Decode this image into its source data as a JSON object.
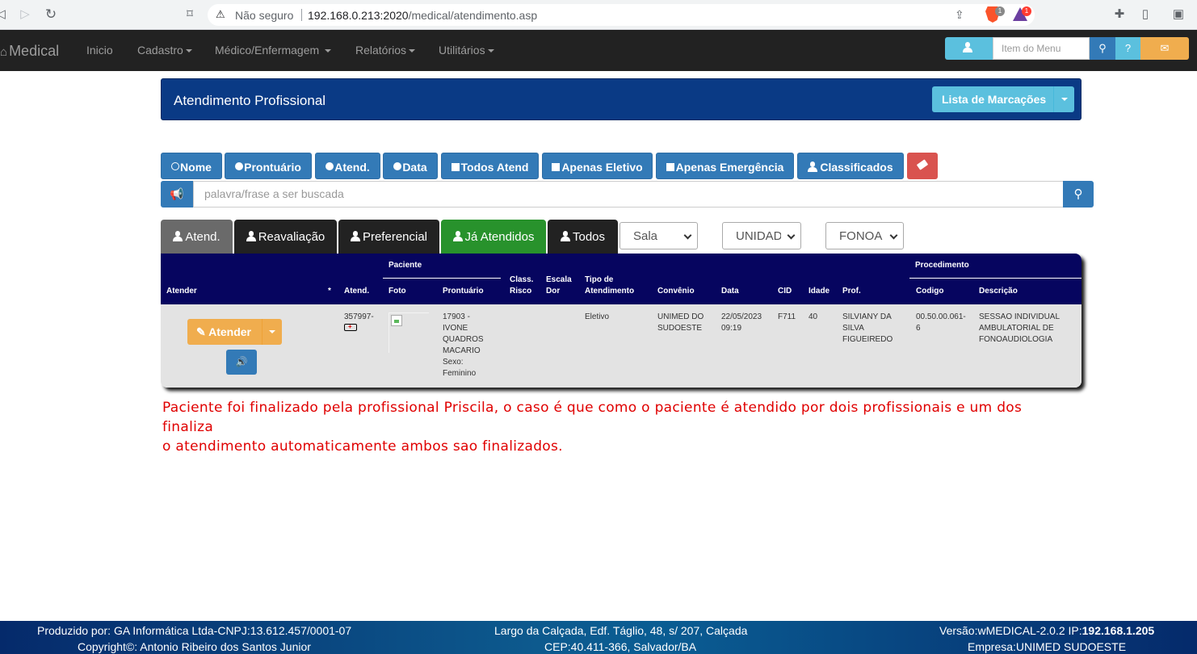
{
  "browser": {
    "insecure_label": "Não seguro",
    "url_host": "192.168.0.213:2020",
    "url_path": "/medical/atendimento.asp",
    "brave_badge": "1",
    "alert_badge": "1"
  },
  "navbar": {
    "brand": "Medical",
    "items": [
      "Inicio",
      "Cadastro",
      "Médico/Enfermagem",
      "Relatórios",
      "Utilitários"
    ],
    "search_placeholder": "Item do Menu"
  },
  "panel": {
    "title": "Atendimento Profissional",
    "lista_button": "Lista de Marcações"
  },
  "filters": [
    "Nome",
    "Prontuário",
    "Atend.",
    "Data",
    "Todos Atend",
    "Apenas Eletivo",
    "Apenas Emergência",
    "Classificados"
  ],
  "search": {
    "placeholder": "palavra/frase a ser buscada"
  },
  "tabs": [
    "Atend.",
    "Reavaliação",
    "Preferencial",
    "Já Atendidos",
    "Todos"
  ],
  "selects": {
    "sala": "Sala",
    "unidade": "UNIDADE",
    "fonoa": "FONOA"
  },
  "table": {
    "group_paciente": "Paciente",
    "group_procedimento": "Procedimento",
    "headers": {
      "atender": "Atender",
      "star": "*",
      "atend": "Atend.",
      "foto": "Foto",
      "prontuario": "Prontuário",
      "class_risco_1": "Class.",
      "class_risco_2": "Risco",
      "escala_dor_1": "Escala",
      "escala_dor_2": "Dor",
      "tipo_1": "Tipo de",
      "tipo_2": "Atendimento",
      "convenio": "Convênio",
      "data": "Data",
      "cid": "CID",
      "idade": "Idade",
      "prof": "Prof.",
      "codigo": "Codigo",
      "descricao": "Descrição"
    },
    "row": {
      "atender_button": "Atender",
      "atend": "357997-",
      "prontuario_lines": [
        "17903 -",
        "IVONE",
        "QUADROS",
        "MACARIO",
        "Sexo:",
        "Feminino"
      ],
      "tipo": "Eletivo",
      "convenio_lines": [
        "UNIMED DO",
        "SUDOESTE"
      ],
      "data_lines": [
        "22/05/2023",
        "09:19"
      ],
      "cid": "F711",
      "idade": "40",
      "prof_lines": [
        "SILVIANY DA",
        "SILVA",
        "FIGUEIREDO"
      ],
      "codigo_lines": [
        "00.50.00.061-",
        "6"
      ],
      "descricao_lines": [
        "SESSAO INDIVIDUAL",
        "AMBULATORIAL DE",
        "FONOAUDIOLOGIA"
      ]
    }
  },
  "note": {
    "line1": "Paciente foi finalizado pela profissional Priscila, o caso é que como o paciente é atendido por dois profissionais e um dos finaliza",
    "line2": "o atendimento automaticamente ambos sao finalizados."
  },
  "footer": {
    "left1": "Produzido por: GA Informática Ltda-CNPJ:13.612.457/0001-07",
    "left2": "Copyright©: Antonio Ribeiro dos Santos Junior",
    "center1": "Largo da Calçada, Edf. Táglio, 48, s/ 207, Calçada",
    "center2": "CEP:40.411-366, Salvador/BA",
    "right1_prefix": "Versão:wMEDICAL-2.0.2 IP:",
    "right1_ip": "192.168.1.205",
    "right2": "Empresa:UNIMED SUDOESTE"
  },
  "colors": {
    "navbar": "#222222",
    "panel": "#0a3a85",
    "primary": "#337ab7",
    "info": "#5bc0de",
    "warning": "#f0ad4e",
    "danger": "#d9534f",
    "success": "#28922c",
    "table_head": "#06055f",
    "note": "#e00000"
  }
}
